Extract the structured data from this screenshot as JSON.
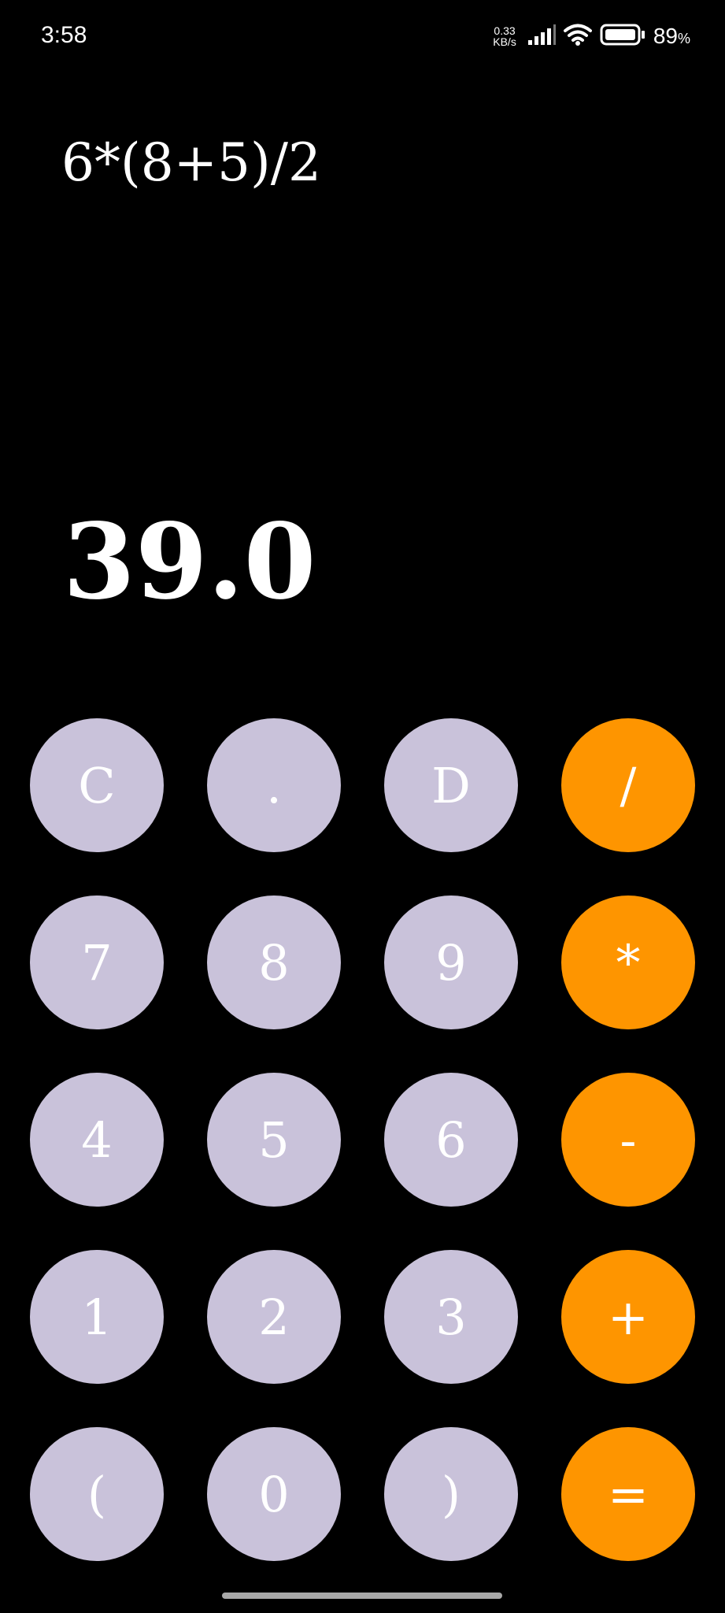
{
  "status_bar": {
    "time": "3:58",
    "net_speed_value": "0.33",
    "net_speed_unit": "KB/s",
    "battery_level": "89",
    "battery_unit": "%",
    "icons": [
      "signal-icon",
      "wifi-icon",
      "battery-icon"
    ]
  },
  "display": {
    "expression": "6*(8+5)/2",
    "result": "39.0"
  },
  "keypad": {
    "rows": [
      [
        "C",
        ".",
        "D",
        "/"
      ],
      [
        "7",
        "8",
        "9",
        "*"
      ],
      [
        "4",
        "5",
        "6",
        "-"
      ],
      [
        "1",
        "2",
        "3",
        "+"
      ],
      [
        "(",
        "0",
        ")",
        "="
      ]
    ]
  },
  "colors": {
    "background": "#000000",
    "key_light": "#c9c2da",
    "key_operator": "#fe9500",
    "text": "#ffffff"
  }
}
